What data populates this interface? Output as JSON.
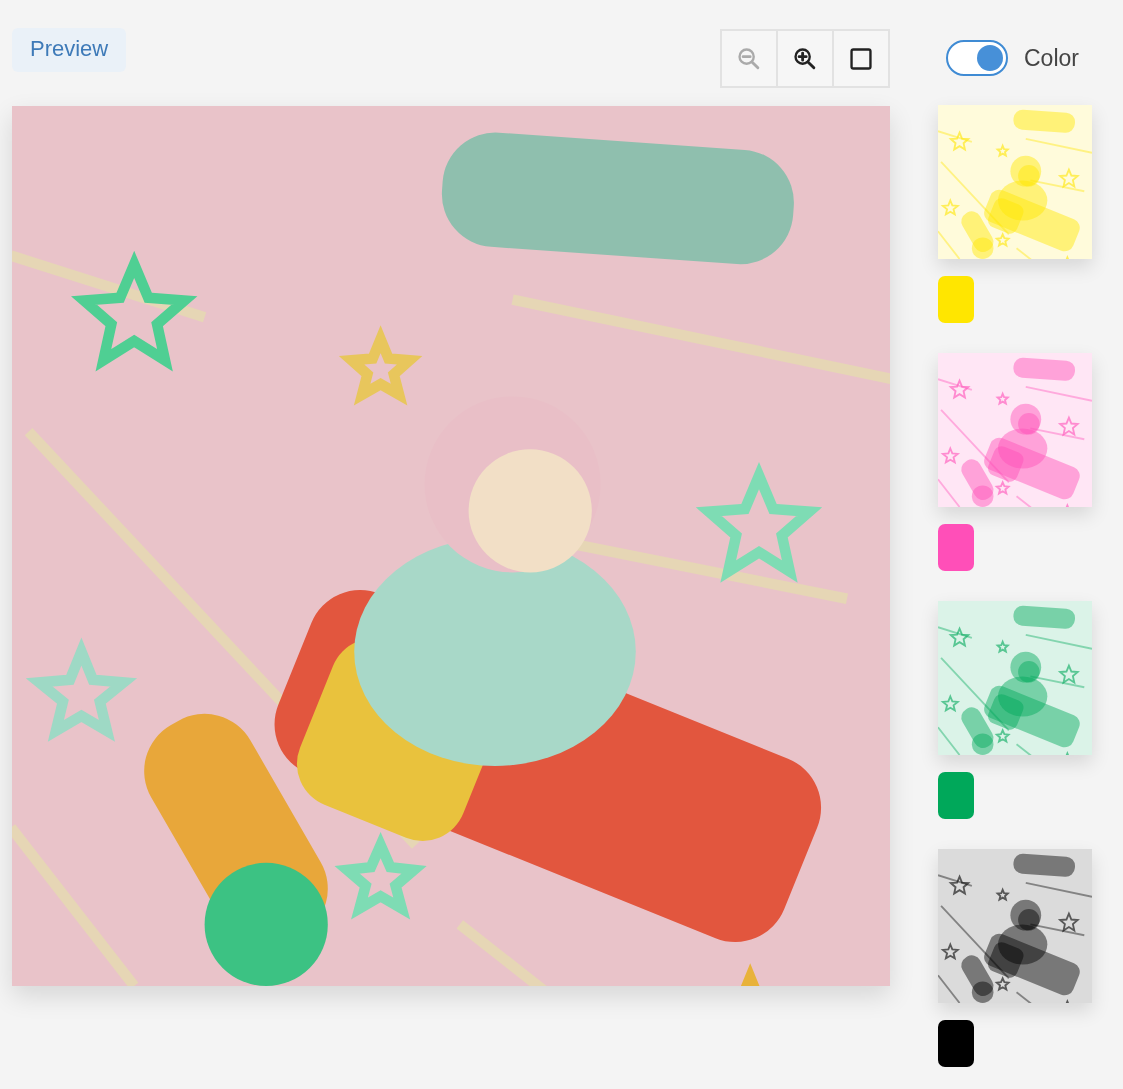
{
  "preview_tab": {
    "label": "Preview",
    "selected": true
  },
  "toolbar": [
    {
      "kind": "zoom-out",
      "disabled": true
    },
    {
      "kind": "zoom-in",
      "disabled": false
    },
    {
      "kind": "fit",
      "disabled": false
    }
  ],
  "color_toggle": {
    "label": "Color",
    "on": true
  },
  "variants": [
    {
      "color": "#ffe600"
    },
    {
      "color": "#ff4fb8"
    },
    {
      "color": "#00a85a"
    },
    {
      "color": "#000000"
    }
  ]
}
